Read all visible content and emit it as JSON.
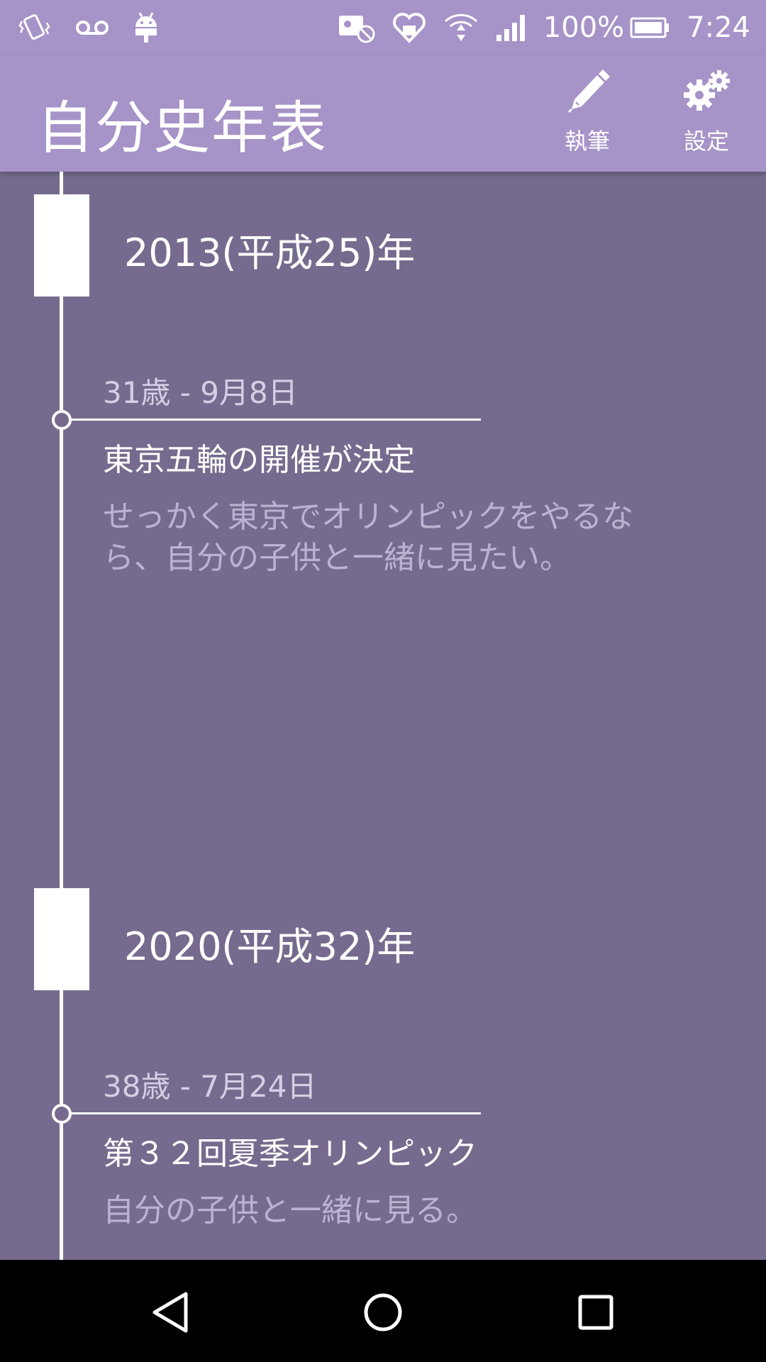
{
  "status_bar": {
    "battery_percent": "100%",
    "time": "7:24",
    "left_icons": [
      "vibrate-icon",
      "voicemail-icon",
      "android-icon"
    ],
    "right_icons": [
      "app-blocked-icon",
      "heart-icon",
      "wifi-icon",
      "signal-icon",
      "battery-icon"
    ]
  },
  "app_bar": {
    "title": "自分史年表",
    "actions": [
      {
        "label": "執筆",
        "icon": "pen-icon"
      },
      {
        "label": "設定",
        "icon": "gears-icon"
      }
    ]
  },
  "timeline": [
    {
      "year": "2013(平成25)年",
      "events": [
        {
          "date": "31歳 - 9月8日",
          "title": "東京五輪の開催が決定",
          "body_lines": [
            "せっかく東京でオリンピックをやるな",
            "ら、自分の子供と一緒に見たい。"
          ]
        }
      ]
    },
    {
      "year": "2020(平成32)年",
      "events": [
        {
          "date": "38歳 - 7月24日",
          "title": "第３２回夏季オリンピック",
          "body_lines": [
            "自分の子供と一緒に見る。"
          ]
        }
      ]
    }
  ],
  "nav_bar": {
    "buttons": [
      "back-icon",
      "home-icon",
      "recents-icon"
    ]
  },
  "colors": {
    "app_bar": "#a693c7",
    "background": "#766b8e",
    "timeline": "#ffffff",
    "date_text": "#d6cee5",
    "body_text": "#bdb2d2"
  }
}
